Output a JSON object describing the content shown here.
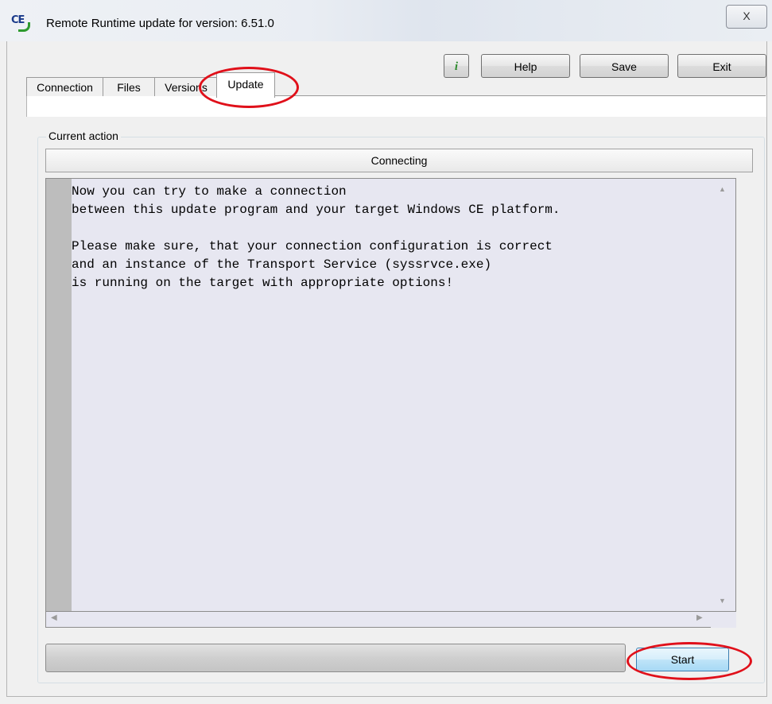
{
  "window": {
    "title": "Remote Runtime update for version: 6.51.0",
    "app_icon": "ce-icon",
    "close_symbol": "X"
  },
  "toolbar": {
    "info_label": "i",
    "help_label": "Help",
    "save_label": "Save",
    "exit_label": "Exit"
  },
  "tabs": [
    {
      "label": "Connection",
      "selected": false
    },
    {
      "label": "Files",
      "selected": false
    },
    {
      "label": "Versions",
      "selected": false
    },
    {
      "label": "Update",
      "selected": true
    }
  ],
  "current_action": {
    "group_label": "Current action",
    "status": "Connecting",
    "log_text": "Now you can try to make a connection\nbetween this update program and your target Windows CE platform.\n\nPlease make sure, that your connection configuration is correct\nand an instance of the Transport Service (syssrvce.exe)\nis running on the target with appropriate options!"
  },
  "progress": {
    "value_percent": 0
  },
  "start_label": "Start",
  "colors": {
    "annotation": "#e0101a",
    "log_background": "#e7e7f1",
    "info_icon": "#2e8b2e"
  }
}
